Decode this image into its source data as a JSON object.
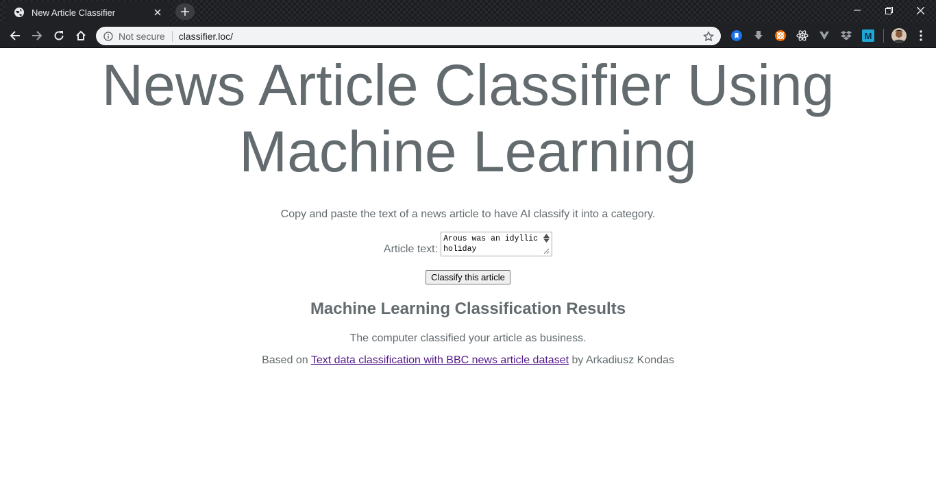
{
  "browser": {
    "tab_title": "New Article Classifier",
    "omnibox": {
      "security_label": "Not secure",
      "url": "classifier.loc/"
    },
    "extensions": [
      "bookmark-ext-icon",
      "download-ext-icon",
      "orange-ext-icon",
      "react-devtools-icon",
      "vue-devtools-icon",
      "dropbox-icon",
      "m-ext-icon"
    ]
  },
  "page": {
    "title": "News Article Classifier Using Machine Learning",
    "intro": "Copy and paste the text of a news article to have AI classify it into a category.",
    "form": {
      "label": "Article text:",
      "textarea_value": "Arous was an idyllic holiday",
      "submit_label": "Classify this article"
    },
    "results": {
      "heading": "Machine Learning Classification Results",
      "text": "The computer classified your article as business."
    },
    "credit": {
      "prefix": "Based on",
      "link_text": "Text data classification with BBC news article dataset",
      "suffix": "by Arkadiusz Kondas"
    }
  },
  "colors": {
    "page_text": "#636b6f",
    "link_visited": "#551a8b",
    "chrome_bg": "#202124"
  }
}
